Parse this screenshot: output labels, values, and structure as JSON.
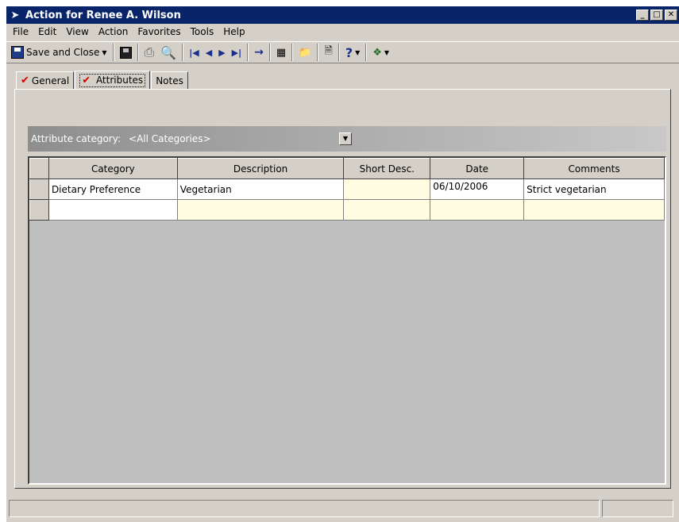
{
  "window": {
    "title": "Action for Renee A. Wilson"
  },
  "menu": [
    "File",
    "Edit",
    "View",
    "Action",
    "Favorites",
    "Tools",
    "Help"
  ],
  "toolbar": {
    "save_close_label": "Save and Close"
  },
  "tabs": [
    {
      "label": "General",
      "checked": true
    },
    {
      "label": "Attributes",
      "checked": true,
      "active": true
    },
    {
      "label": "Notes",
      "checked": false
    }
  ],
  "attributes": {
    "category_label": "Attribute category:",
    "category_value": "<All Categories>"
  },
  "grid": {
    "columns": [
      "Category",
      "Description",
      "Short Desc.",
      "Date",
      "Comments"
    ],
    "rows": [
      [
        "Dietary Preference",
        "Vegetarian",
        "",
        "06/10/2006",
        "Strict vegetarian"
      ],
      [
        "",
        "",
        "",
        "",
        ""
      ]
    ]
  },
  "colors": {
    "titlebar": "#0a246a",
    "check": "#d40000",
    "highlight_cell": "#fffce2"
  }
}
